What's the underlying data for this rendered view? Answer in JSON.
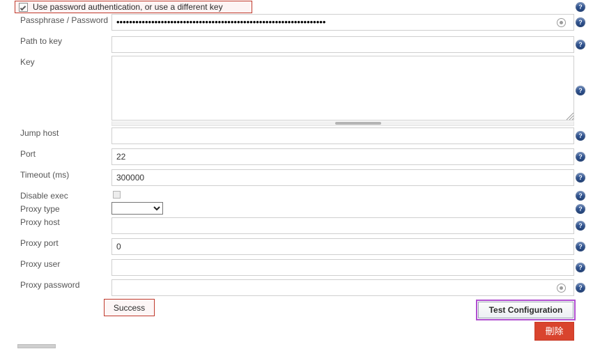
{
  "colors": {
    "highlight_red": "#c0392b",
    "highlight_purple": "#b04fd0",
    "help_icon_blue": "#2f5596",
    "delete_button_red": "#d9442e"
  },
  "checkbox_row": {
    "label": "Use password authentication, or use a different key",
    "checked": true,
    "icon": "checkbox-checked-icon"
  },
  "fields": [
    {
      "label": "Passphrase / Password",
      "value": "••••••••••••••••••••••••••••••••••••••••••••••••••••••••••••••••••",
      "placeholder": "",
      "type": "password",
      "has_reveal_icon": true,
      "reveal_icon": "password-reveal-icon"
    },
    {
      "label": "Path to key",
      "value": "",
      "placeholder": "",
      "type": "text",
      "has_reveal_icon": false
    },
    {
      "label": "Key",
      "value": "",
      "placeholder": "",
      "type": "textarea",
      "has_reveal_icon": false
    },
    {
      "label": "Jump host",
      "value": "",
      "placeholder": "",
      "type": "text",
      "has_reveal_icon": false
    },
    {
      "label": "Port",
      "value": "22",
      "placeholder": "",
      "type": "text",
      "has_reveal_icon": false
    },
    {
      "label": "Timeout (ms)",
      "value": "300000",
      "placeholder": "",
      "type": "text",
      "has_reveal_icon": false
    },
    {
      "label": "Disable exec",
      "value": "",
      "placeholder": "",
      "type": "checkbox",
      "checked": false,
      "has_reveal_icon": false
    },
    {
      "label": "Proxy type",
      "value": "",
      "placeholder": "",
      "type": "select",
      "options": [
        ""
      ],
      "has_reveal_icon": false
    },
    {
      "label": "Proxy host",
      "value": "",
      "placeholder": "",
      "type": "text",
      "has_reveal_icon": false
    },
    {
      "label": "Proxy port",
      "value": "0",
      "placeholder": "",
      "type": "text",
      "has_reveal_icon": false
    },
    {
      "label": "Proxy user",
      "value": "",
      "placeholder": "",
      "type": "text",
      "has_reveal_icon": false
    },
    {
      "label": "Proxy password",
      "value": "",
      "placeholder": "",
      "type": "password",
      "has_reveal_icon": true,
      "reveal_icon": "password-reveal-icon"
    }
  ],
  "help_icons": {
    "glyph": "?",
    "name": "help-icon",
    "count": 12
  },
  "status": {
    "text": "Success"
  },
  "actions": {
    "test_configuration_label": "Test Configuration",
    "delete_label": "刪除"
  }
}
